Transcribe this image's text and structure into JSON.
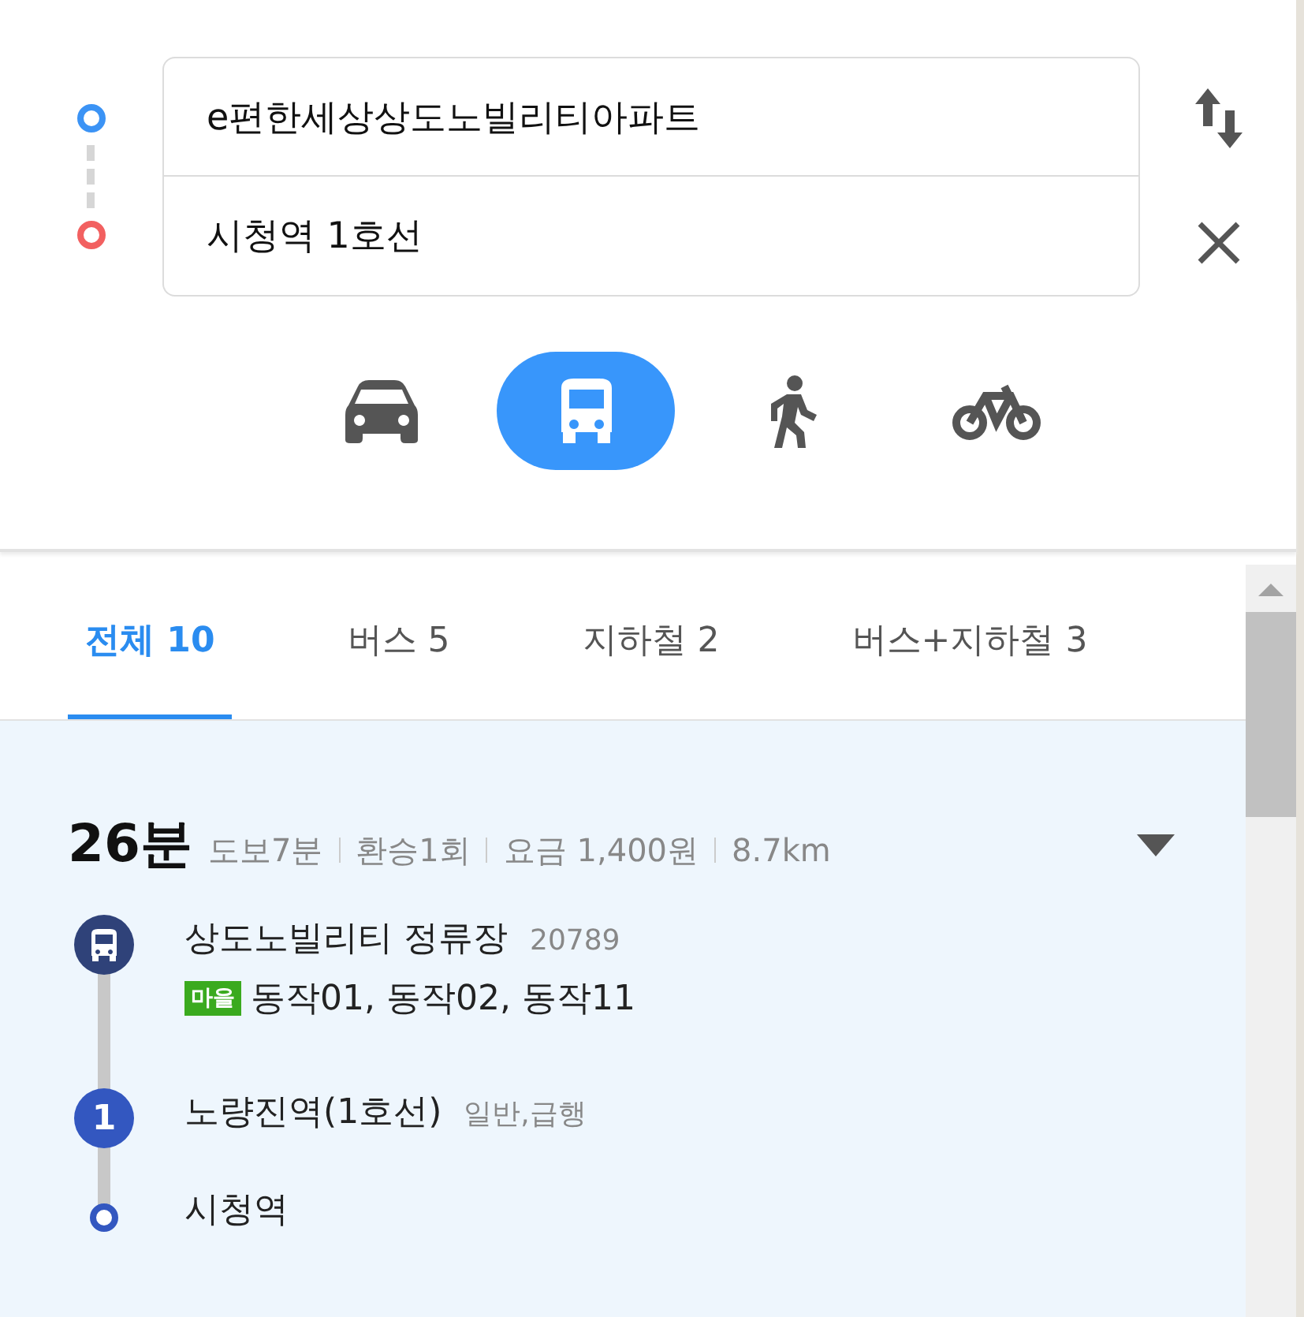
{
  "route": {
    "origin": "e편한세상상도노빌리티아파트",
    "destination": "시청역 1호선"
  },
  "modes": [
    {
      "kind": "car",
      "selected": false
    },
    {
      "kind": "bus",
      "selected": true
    },
    {
      "kind": "walk",
      "selected": false
    },
    {
      "kind": "bike",
      "selected": false
    }
  ],
  "tabs": [
    {
      "label": "전체 10",
      "selected": true
    },
    {
      "label": "버스 5",
      "selected": false
    },
    {
      "label": "지하철 2",
      "selected": false
    },
    {
      "label": "버스+지하철 3",
      "selected": false
    }
  ],
  "result": {
    "duration": "26분",
    "details": [
      "도보7분",
      "환승1회",
      "요금 1,400원",
      "8.7km"
    ],
    "steps": [
      {
        "kind": "bus",
        "name": "상도노빌리티 정류장",
        "note": "20789",
        "tag": "마을",
        "lines": "동작01, 동작02, 동작11"
      },
      {
        "kind": "subway",
        "badge": "1",
        "name": "노량진역(1호선)",
        "note": "일반,급행"
      },
      {
        "kind": "end",
        "name": "시청역"
      }
    ]
  }
}
